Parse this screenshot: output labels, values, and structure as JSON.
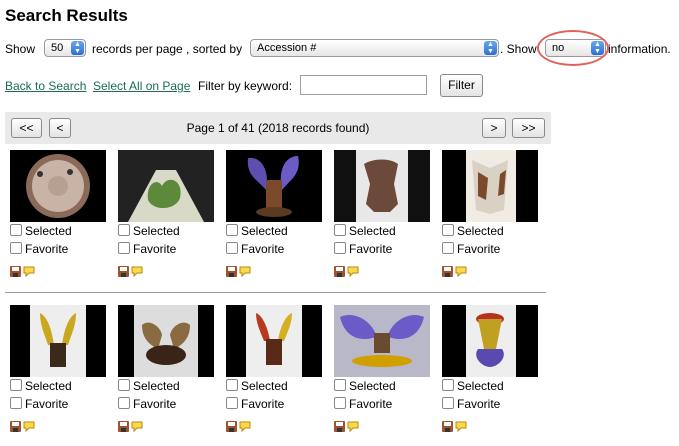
{
  "page": {
    "title": "Search Results"
  },
  "controls": {
    "show_label": "Show",
    "records_value": "50",
    "records_per_page_text": "records per page , sorted by",
    "sort_value": "Accession #",
    "show2_label": ". Show",
    "info_value": "no",
    "information_text": "information."
  },
  "actions": {
    "back_to_search": "Back to Search",
    "select_all": "Select All on Page",
    "filter_label": "Filter by keyword:",
    "filter_value": "",
    "filter_button": "Filter"
  },
  "pager": {
    "first": "<<",
    "prev": "<",
    "info": "Page 1 of 41 (2018 records found)",
    "next": ">",
    "last": ">>"
  },
  "card_labels": {
    "selected": "Selected",
    "favorite": "Favorite"
  },
  "records": [
    {
      "thumb": "round-plate",
      "selected": false,
      "favorite": false
    },
    {
      "thumb": "green-sculpture",
      "selected": false,
      "favorite": false
    },
    {
      "thumb": "purple-winged-vessel",
      "selected": false,
      "favorite": false
    },
    {
      "thumb": "brown-figure",
      "selected": false,
      "favorite": false
    },
    {
      "thumb": "white-brown-wings",
      "selected": false,
      "favorite": false
    },
    {
      "thumb": "yellow-horned-vessel",
      "selected": false,
      "favorite": false
    },
    {
      "thumb": "dark-winged-form",
      "selected": false,
      "favorite": false
    },
    {
      "thumb": "red-yellow-vessel",
      "selected": false,
      "favorite": false
    },
    {
      "thumb": "purple-wings-wide",
      "selected": false,
      "favorite": false
    },
    {
      "thumb": "purple-red-goblet",
      "selected": false,
      "favorite": false
    }
  ],
  "icons": {
    "save": "floppy-disk-icon",
    "comment": "comment-bubble-icon"
  },
  "colors": {
    "link": "#1a6b58",
    "highlight": "#e0625a",
    "pager_bg": "#e9e9e9"
  }
}
